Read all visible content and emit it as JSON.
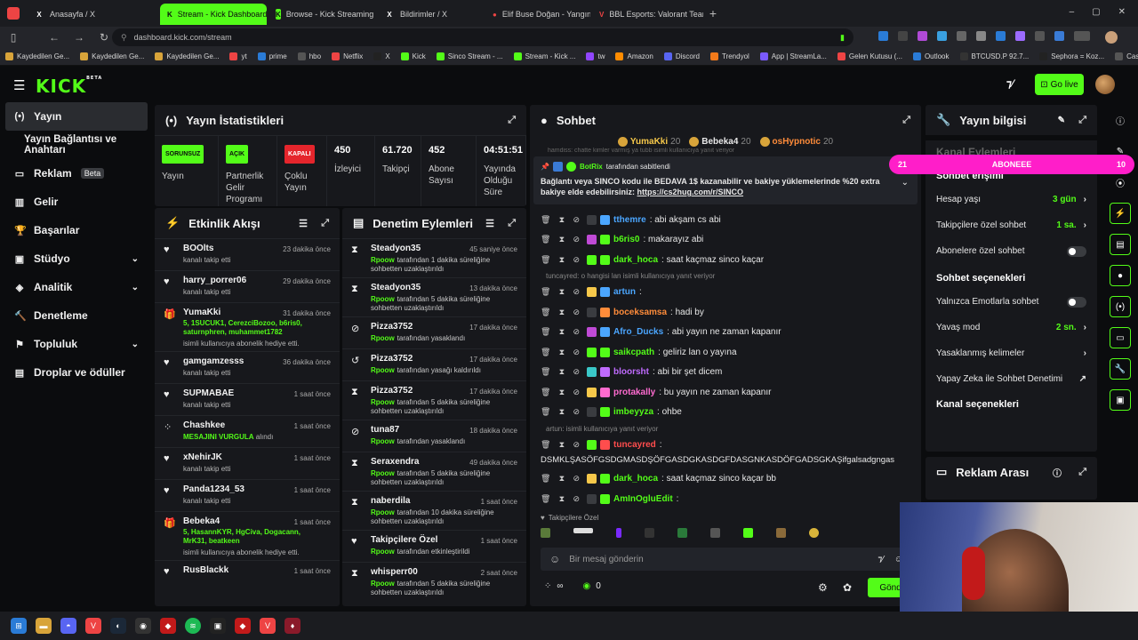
{
  "browser": {
    "tabs": [
      {
        "label": "Anasayfa / X",
        "icon": "X",
        "color": "#1b1c20",
        "ic": "#fff",
        "width": 148
      },
      {
        "label": "Stream - Kick Dashboard",
        "icon": "K",
        "color": "#53fc18",
        "ic": "#0b0c0e",
        "active": true,
        "width": 120
      },
      {
        "label": "Browse - Kick Streaming",
        "icon": "K",
        "color": "#53fc18",
        "ic": "#0b0c0e",
        "width": 120
      },
      {
        "label": "Bildirimler / X",
        "icon": "X",
        "color": "#1b1c20",
        "ic": "#fff",
        "width": 120
      },
      {
        "label": "Elif Buse Doğan - Yangın Y...",
        "icon": "●",
        "color": "#1b1c20",
        "ic": "#e44",
        "width": 118
      },
      {
        "label": "BBL Esports: Valorant Team...",
        "icon": "V",
        "color": "#1b1c20",
        "ic": "#e44",
        "width": 125
      }
    ],
    "new_tab": "+",
    "url": "dashboard.kick.com/stream",
    "bookmarks": [
      "Kaydedilen Ge...",
      "Kaydedilen Ge...",
      "Kaydedilen Ge...",
      "yt",
      "prime",
      "hbo",
      "Netflix",
      "X",
      "Kick",
      "Sinco Stream - ...",
      "Stream - Kick ...",
      "tw",
      "Amazon",
      "Discord",
      "Trendyol",
      "App | StreamLa...",
      "Gelen Kutusu (...",
      "Outlook",
      "BTCUSD.P 92.7...",
      "Sephora = Koz...",
      "CaseHug x Sin..."
    ]
  },
  "header": {
    "logo": "KICK",
    "beta": "BETA",
    "go_live": "Go live"
  },
  "sidebar": {
    "items": [
      {
        "label": "Yayın",
        "icon": "(•)",
        "active": true
      },
      {
        "label": "Yayın Bağlantısı ve Anahtarı",
        "icon": ""
      },
      {
        "label": "Reklam",
        "icon": "▭",
        "beta": "Beta"
      },
      {
        "label": "Gelir",
        "icon": "▥"
      },
      {
        "label": "Başarılar",
        "icon": "🏆"
      },
      {
        "label": "Stüdyo",
        "icon": "▣",
        "chev": "⌄"
      },
      {
        "label": "Analitik",
        "icon": "◈",
        "chev": "⌄"
      },
      {
        "label": "Denetleme",
        "icon": "🔨"
      },
      {
        "label": "Topluluk",
        "icon": "⚑",
        "chev": "⌄"
      },
      {
        "label": "Droplar ve ödüller",
        "icon": "▤"
      }
    ]
  },
  "stats": {
    "title": "Yayın İstatistikleri",
    "cells": [
      {
        "pill": "SORUNSUZ",
        "pill_color": "#53fc18",
        "label": "Yayın"
      },
      {
        "pill": "AÇIK",
        "pill_color": "#53fc18",
        "label": "Partnerlik Gelir Programı"
      },
      {
        "pill": "KAPALI",
        "pill_color": "#e5252c",
        "label": "Çoklu Yayın"
      },
      {
        "value": "450",
        "label": "İzleyici"
      },
      {
        "value": "61.720",
        "label": "Takipçi"
      },
      {
        "value": "452",
        "label": "Abone Sayısı"
      },
      {
        "value": "04:51:51",
        "label": "Yayında Olduğu Süre"
      }
    ]
  },
  "activity": {
    "title": "Etkinlik Akışı",
    "items": [
      {
        "icon": "♥",
        "name": "BOOlts",
        "sub": "kanalı takip etti",
        "time": "23 dakika önce"
      },
      {
        "icon": "♥",
        "name": "harry_porrer06",
        "sub": "kanalı takip etti",
        "time": "29 dakika önce"
      },
      {
        "icon": "🎁",
        "name": "YumaKki",
        "green": "5, 1SUCUK1, CerezciBozoo, b6ris0, saturnphren, muhammet1782",
        "sub": "isimli kullanıcıya abonelik hediye etti.",
        "time": "31 dakika önce"
      },
      {
        "icon": "♥",
        "name": "gamgamzesss",
        "sub": "kanalı takip etti",
        "time": "36 dakika önce"
      },
      {
        "icon": "♥",
        "name": "SUPMABAE",
        "sub": "kanalı takip etti",
        "time": "1 saat önce"
      },
      {
        "icon": "⁘",
        "name": "Chashkee",
        "sub": "MESAJINI VURGULA",
        "sub2": " alındı",
        "time": "1 saat önce"
      },
      {
        "icon": "♥",
        "name": "xNehirJK",
        "sub": "kanalı takip etti",
        "time": "1 saat önce"
      },
      {
        "icon": "♥",
        "name": "Panda1234_53",
        "sub": "kanalı takip etti",
        "time": "1 saat önce"
      },
      {
        "icon": "🎁",
        "name": "Bebeka4",
        "green": "5, HasannKYR, HgCiva, Dogacann, MrK31, beatkeen",
        "sub": "isimli kullanıcıya abonelik hediye etti.",
        "time": "1 saat önce"
      },
      {
        "icon": "♥",
        "name": "RusBlackk",
        "sub": "",
        "time": "1 saat önce"
      }
    ]
  },
  "moderation": {
    "title": "Denetim Eylemleri",
    "items": [
      {
        "icon": "⧗",
        "name": "Steadyon35",
        "mod": "Rpoow",
        "sub": "tarafından 1 dakika süreliğine sohbetten uzaklaştırıldı",
        "time": "45 saniye önce"
      },
      {
        "icon": "⧗",
        "name": "Steadyon35",
        "mod": "Rpoow",
        "sub": "tarafından 5 dakika süreliğine sohbetten uzaklaştırıldı",
        "time": "13 dakika önce"
      },
      {
        "icon": "⊘",
        "name": "Pizza3752",
        "mod": "Rpoow",
        "sub": "tarafından yasaklandı",
        "time": "17 dakika önce"
      },
      {
        "icon": "↺",
        "name": "Pizza3752",
        "mod": "Rpoow",
        "sub": "tarafından yasağı kaldırıldı",
        "time": "17 dakika önce"
      },
      {
        "icon": "⧗",
        "name": "Pizza3752",
        "mod": "Rpoow",
        "sub": "tarafından 5 dakika süreliğine sohbetten uzaklaştırıldı",
        "time": "17 dakika önce"
      },
      {
        "icon": "⊘",
        "name": "tuna87",
        "mod": "Rpoow",
        "sub": "tarafından yasaklandı",
        "time": "18 dakika önce"
      },
      {
        "icon": "⧗",
        "name": "Seraxendra",
        "mod": "Rpoow",
        "sub": "tarafından 5 dakika süreliğine sohbetten uzaklaştırıldı",
        "time": "49 dakika önce"
      },
      {
        "icon": "⧗",
        "name": "naberdila",
        "mod": "Rpoow",
        "sub": "tarafından 10 dakika süreliğine sohbetten uzaklaştırıldı",
        "time": "1 saat önce"
      },
      {
        "icon": "♥",
        "name": "Takipçilere Özel",
        "mod": "Rpoow",
        "sub": "tarafından etkinleştirildi",
        "time": "1 saat önce"
      },
      {
        "icon": "⧗",
        "name": "whisperr00",
        "mod": "Rpoow",
        "sub": "tarafından 5 dakika süreliğine sohbetten uzaklaştırıldı",
        "time": "2 saat önce"
      }
    ]
  },
  "chat": {
    "title": "Sohbet",
    "top_gifters": [
      {
        "name": "YumaKki",
        "count": "20"
      },
      {
        "name": "Bebeka4",
        "count": "20"
      },
      {
        "name": "osHypnotic",
        "count": "20"
      }
    ],
    "faded_line": "hamdiss: chatte kimler varmış ya tubb isimli kullanıcıya yanıt veriyor",
    "pinned": {
      "by": "BotRix",
      "by_suffix": "tarafından sabitlendi",
      "text": "Bağlantı veya SINCO kodu ile BEDAVA 1$ kazanabilir ve bakiye yüklemelerinde %20 extra bakiye elde edebilirsiniz: ",
      "link": "https://cs2hug.com/r/SINCO"
    },
    "messages": [
      {
        "name": "tthemre",
        "color": "#4ba6ff",
        "text": ": abi akşam cs abi"
      },
      {
        "name": "b6ris0",
        "color": "#53fc18",
        "text": ": makarayız abi"
      },
      {
        "name": "dark_hoca",
        "color": "#53fc18",
        "text": ": saat kaçmaz sinco kaçar"
      },
      {
        "reply": "tuncayred: o hangisi lan isimli kullanıcıya yanıt veriyor"
      },
      {
        "name": "artun",
        "color": "#4ba6ff",
        "text": ":"
      },
      {
        "name": "boceksamsa",
        "color": "#ff8c3a",
        "text": ": hadi by"
      },
      {
        "name": "Afro_Ducks",
        "color": "#4ba6ff",
        "text": ": abi yayın ne zaman kapanır"
      },
      {
        "name": "saikcpath",
        "color": "#53fc18",
        "text": ": geliriz lan o yayına"
      },
      {
        "name": "bloorsht",
        "color": "#c06bff",
        "text": ": abi bir şet dicem"
      },
      {
        "name": "protakally",
        "color": "#ff6bd0",
        "text": ": bu yayın ne zaman kapanır"
      },
      {
        "name": "imbeyyza",
        "color": "#53fc18",
        "text": ": ohbe"
      },
      {
        "reply": "artun: isimli kullanıcıya yanıt veriyor"
      },
      {
        "name": "tuncayred",
        "color": "#ff4d4d",
        "text": ":"
      },
      {
        "wrap": "DSMKLŞASÖFGSDGMASDŞÖFGASDGKASDGFDASGNKASDÖFGADSGKAŞifgalsadgngas"
      },
      {
        "name": "dark_hoca",
        "color": "#53fc18",
        "text": ": saat kaçmaz sinco kaçar bb"
      },
      {
        "name": "AmInOgluEdit",
        "color": "#53fc18",
        "text": ":"
      }
    ],
    "followers_only": "Takipçilere Özel",
    "placeholder": "Bir mesaj gönderin",
    "viewers_symbol": "∞",
    "points": "0",
    "send": "Gönder"
  },
  "sub_goal": {
    "left": "21",
    "label": "ABONEEE",
    "right": "10"
  },
  "stream_info": {
    "title": "Yayın bilgisi",
    "channel_actions": "Kanal Eylemleri",
    "chat_access": "Sohbet erişimi",
    "items": [
      {
        "label": "Hesap yaşı",
        "value": "3 gün",
        "chev": "›"
      },
      {
        "label": "Takipçilere özel sohbet",
        "value": "1 sa.",
        "chev": "›"
      },
      {
        "label": "Abonelere özel sohbet",
        "toggle": true
      }
    ],
    "chat_options": "Sohbet seçenekleri",
    "items2": [
      {
        "label": "Yalnızca Emotlarla sohbet",
        "toggle": true
      },
      {
        "label": "Yavaş mod",
        "value": "2 sn.",
        "chev": "›"
      },
      {
        "label": "Yasaklanmış kelimeler",
        "chev": "›"
      },
      {
        "label": "Yapay Zeka ile Sohbet Denetimi",
        "chev": "↗"
      }
    ],
    "channel_options": "Kanal seçenekleri",
    "ad_break": "Reklam Arası"
  },
  "colors": {
    "accent": "#53fc18",
    "panel": "#17181c",
    "pink": "#ff1ec9",
    "danger": "#e5252c"
  }
}
